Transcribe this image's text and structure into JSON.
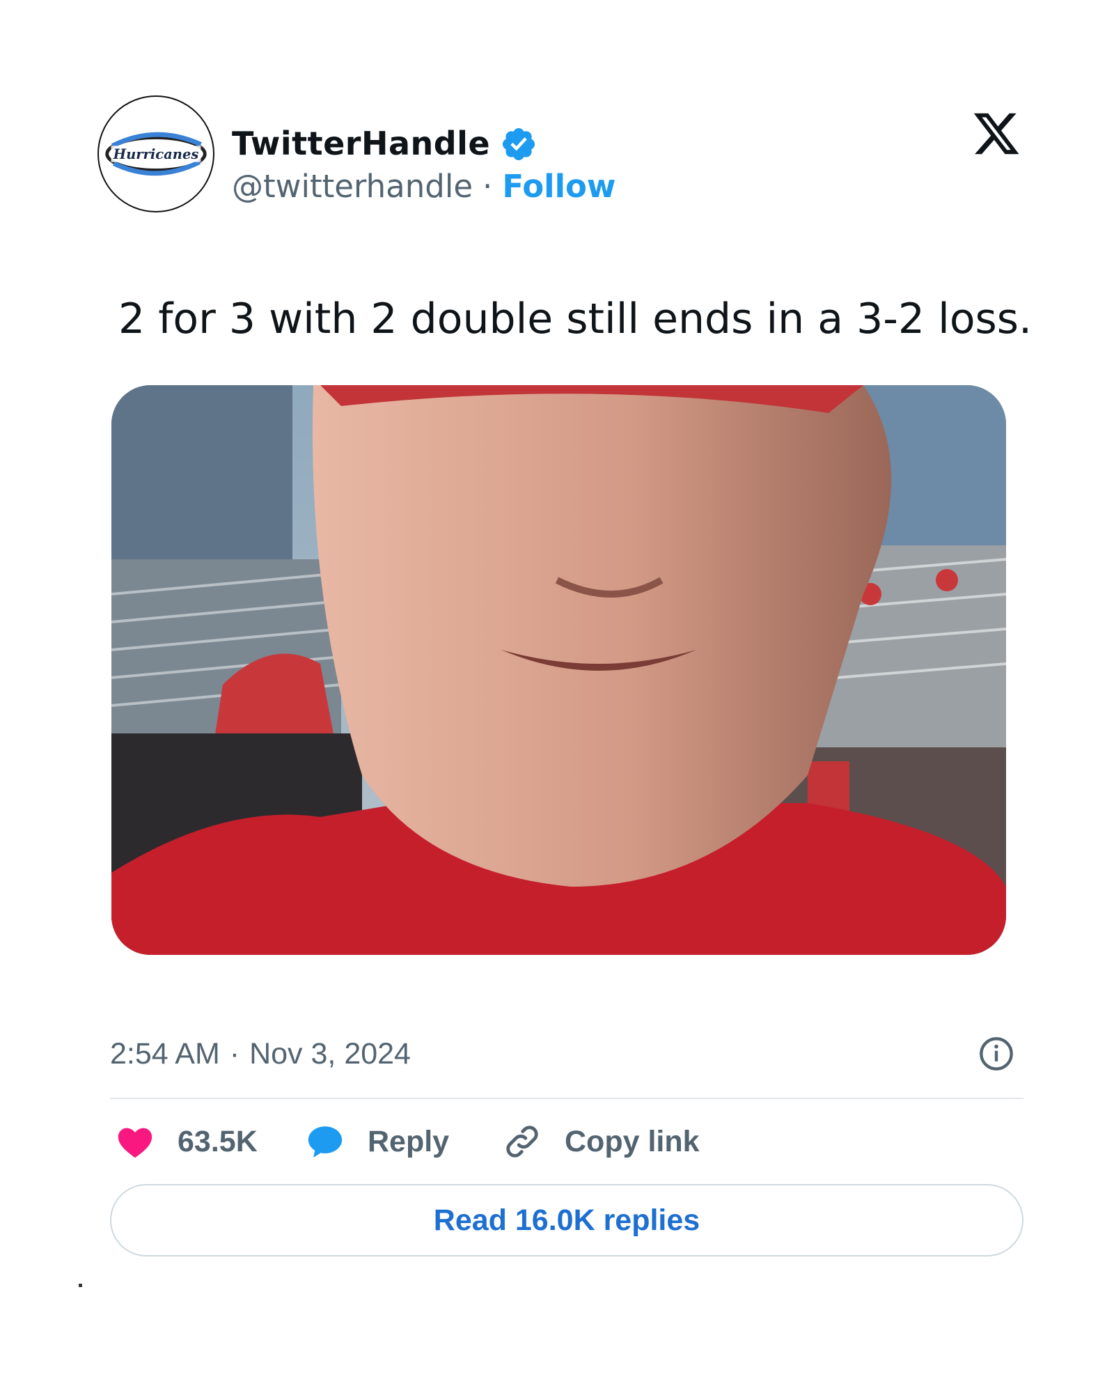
{
  "author": {
    "display_name": "TwitterHandle",
    "handle": "@twitterhandle",
    "separator": "·",
    "follow_label": "Follow",
    "avatar_logo_text": "Hurricanes",
    "verified_icon": "verified-badge-icon",
    "brand_color": "#1d9bf0"
  },
  "platform_logo": "x-logo-icon",
  "tweet": {
    "text": "2 for 3 with 2 double still ends in a 3-2 loss.",
    "media_icon": "video-thumbnail"
  },
  "meta": {
    "time": "2:54 AM",
    "separator": "·",
    "date": "Nov 3, 2024",
    "info_icon": "info-icon"
  },
  "actions": {
    "like_count": "63.5K",
    "like_icon": "heart-icon",
    "like_color": "#f91880",
    "reply_label": "Reply",
    "reply_icon": "speech-bubble-icon",
    "reply_color": "#1d9bf0",
    "copy_label": "Copy link",
    "copy_icon": "link-icon"
  },
  "replies_button": {
    "label": "Read 16.0K replies"
  }
}
